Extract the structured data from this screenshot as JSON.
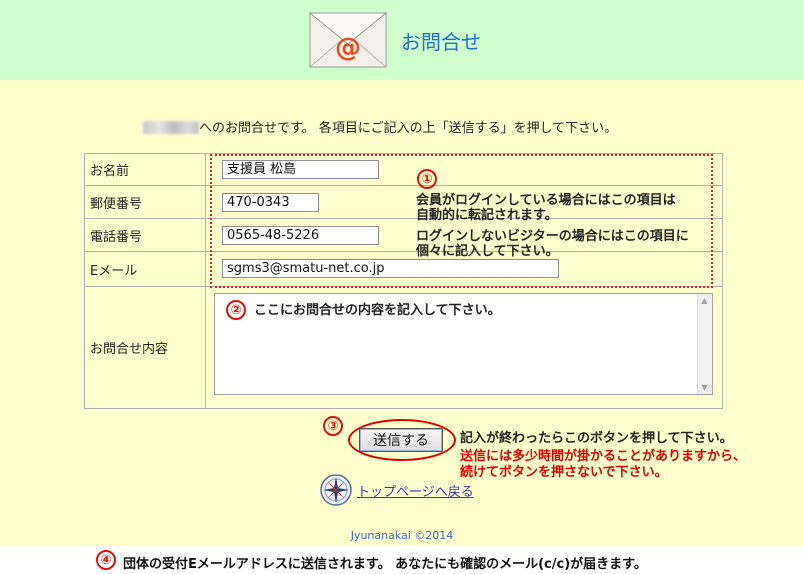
{
  "header": {
    "title": "お問合せ",
    "logo_icon": "mail-envelope-icon"
  },
  "intro": {
    "text": "へのお問合せです。 各項目にご記入の上「送信する」を押して下さい。"
  },
  "form": {
    "name": {
      "label": "お名前",
      "value": "支援員  松島"
    },
    "postal": {
      "label": "郵便番号",
      "value": "470-0343"
    },
    "phone": {
      "label": "電話番号",
      "value": "0565-48-5226"
    },
    "email": {
      "label": "Eメール",
      "value": "sgms3@smatu-net.co.jp"
    },
    "inquiry": {
      "label": "お問合せ内容",
      "value": ""
    }
  },
  "annotations": {
    "n1": "①",
    "n1_line1": "会員がログインしている場合にはこの項目は",
    "n1_line2": "自動的に転記されます。",
    "n1_line3": "ログインしないビジターの場合にはこの項目に",
    "n1_line4": "個々に記入して下さい。",
    "n2": "②",
    "n2_text": "ここにお問合せの内容を記入して下さい。",
    "n3": "③",
    "n3_text": "記入が終わったらこのボタンを押して下さい。",
    "n3_red1": "送信には多少時間が掛かることがありますから、",
    "n3_red2": "続けてボタンを押さないで下さい。",
    "n4": "④",
    "n4_text": "団体の受付Eメールアドレスに送信されます。 あなたにも確認のメール(c/c)が届きます。"
  },
  "submit": {
    "label": "送信する"
  },
  "top_link": {
    "label": "トップページへ戻る",
    "icon": "compass-icon"
  },
  "footer": {
    "copyright": "Jyunanakai ©2014"
  },
  "colors": {
    "header_bg": "#ccffcc",
    "main_bg": "#ffffcc",
    "accent_red": "#e00000",
    "title_blue": "#1e6fd0"
  }
}
